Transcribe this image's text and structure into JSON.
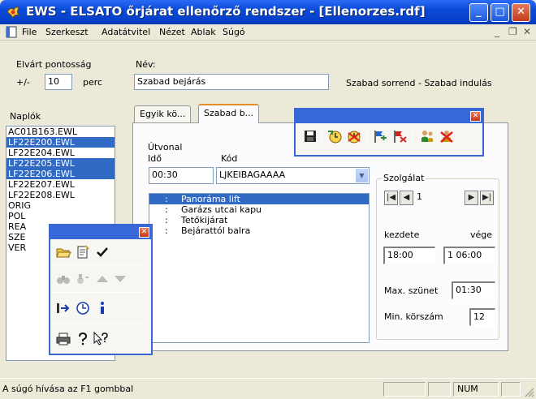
{
  "window": {
    "title": "EWS - ELSATO őrjárat ellenőrző rendszer - [Ellenorzes.rdf]",
    "minimize_glyph": "_",
    "maximize_glyph": "□",
    "close_glyph": "✕"
  },
  "menu": {
    "items": [
      "File",
      "Szerkeszt",
      "Adatátvitel",
      "Nézet",
      "Ablak",
      "Súgó"
    ],
    "mdi_minimize": "_",
    "mdi_restore": "❐",
    "mdi_close": "✕"
  },
  "form": {
    "accuracy_label": "Elvárt pontosság",
    "accuracy_prefix": "+/-",
    "accuracy_value": "10",
    "accuracy_unit": "perc",
    "name_label": "Név:",
    "name_value": "Szabad bejárás",
    "mode_text": "Szabad sorrend - Szabad indulás"
  },
  "logs": {
    "label": "Naplók",
    "items": [
      {
        "text": "AC01B163.EWL",
        "selected": false
      },
      {
        "text": "LF22E200.EWL",
        "selected": true
      },
      {
        "text": "LF22E204.EWL",
        "selected": false
      },
      {
        "text": "LF22E205.EWL",
        "selected": true
      },
      {
        "text": "LF22E206.EWL",
        "selected": true
      },
      {
        "text": "LF22E207.EWL",
        "selected": false
      },
      {
        "text": "LF22E208.EWL",
        "selected": false
      },
      {
        "text": "ORIG",
        "selected": false
      },
      {
        "text": "POL",
        "selected": false
      },
      {
        "text": "REA",
        "selected": false
      },
      {
        "text": "SZE",
        "selected": false
      },
      {
        "text": "VER",
        "selected": false
      }
    ]
  },
  "tabs": [
    {
      "label": "Egyik kö..."
    },
    {
      "label": "Szabad b..."
    }
  ],
  "route": {
    "utvonal_label": "Útvonal",
    "ido_label": "Idő",
    "kod_label": "Kód",
    "time_value": "00:30",
    "code_value": "LJKEIBAGAAAA",
    "combo_arrow": "▼",
    "points": [
      {
        "colon": ":",
        "name": "Panoráma lift",
        "selected": true
      },
      {
        "colon": ":",
        "name": "Garázs utcai kapu",
        "selected": false
      },
      {
        "colon": ":",
        "name": "Tetőkijárat",
        "selected": false
      },
      {
        "colon": ":",
        "name": "Bejárattól balra",
        "selected": false
      }
    ]
  },
  "service": {
    "title": "Szolgálat",
    "nav_first": "|◀",
    "nav_prev": "◀",
    "nav_value": "1",
    "nav_next": "▶",
    "nav_last": "▶|",
    "start_label": "kezdete",
    "end_label": "vége",
    "start_value": "18:00",
    "end_value": "1 06:00",
    "max_break_label": "Max. szünet",
    "max_break_value": "01:30",
    "min_rounds_label": "Min. körszám",
    "min_rounds_value": "12"
  },
  "status": {
    "help_text": "A súgó hívása az F1 gombbal",
    "num": "NUM"
  },
  "toolbar_top": {
    "close_glyph": "✕",
    "icons": [
      "save-icon",
      "clock-start-icon",
      "alarm-clock-icon",
      "flag-add-icon",
      "flag-remove-icon",
      "people-icon",
      "person-x-icon"
    ]
  },
  "toolbar_left": {
    "close_glyph": "✕",
    "icons": [
      "open-folder-icon",
      "paste-doc-icon",
      "check-icon",
      "binoculars-icon",
      "binoculars-next-icon",
      "arrow-up-icon",
      "arrow-down-icon",
      "exit-arrow-icon",
      "clock-icon",
      "info-icon",
      "printer-icon",
      "help-icon",
      "context-help-icon"
    ]
  }
}
